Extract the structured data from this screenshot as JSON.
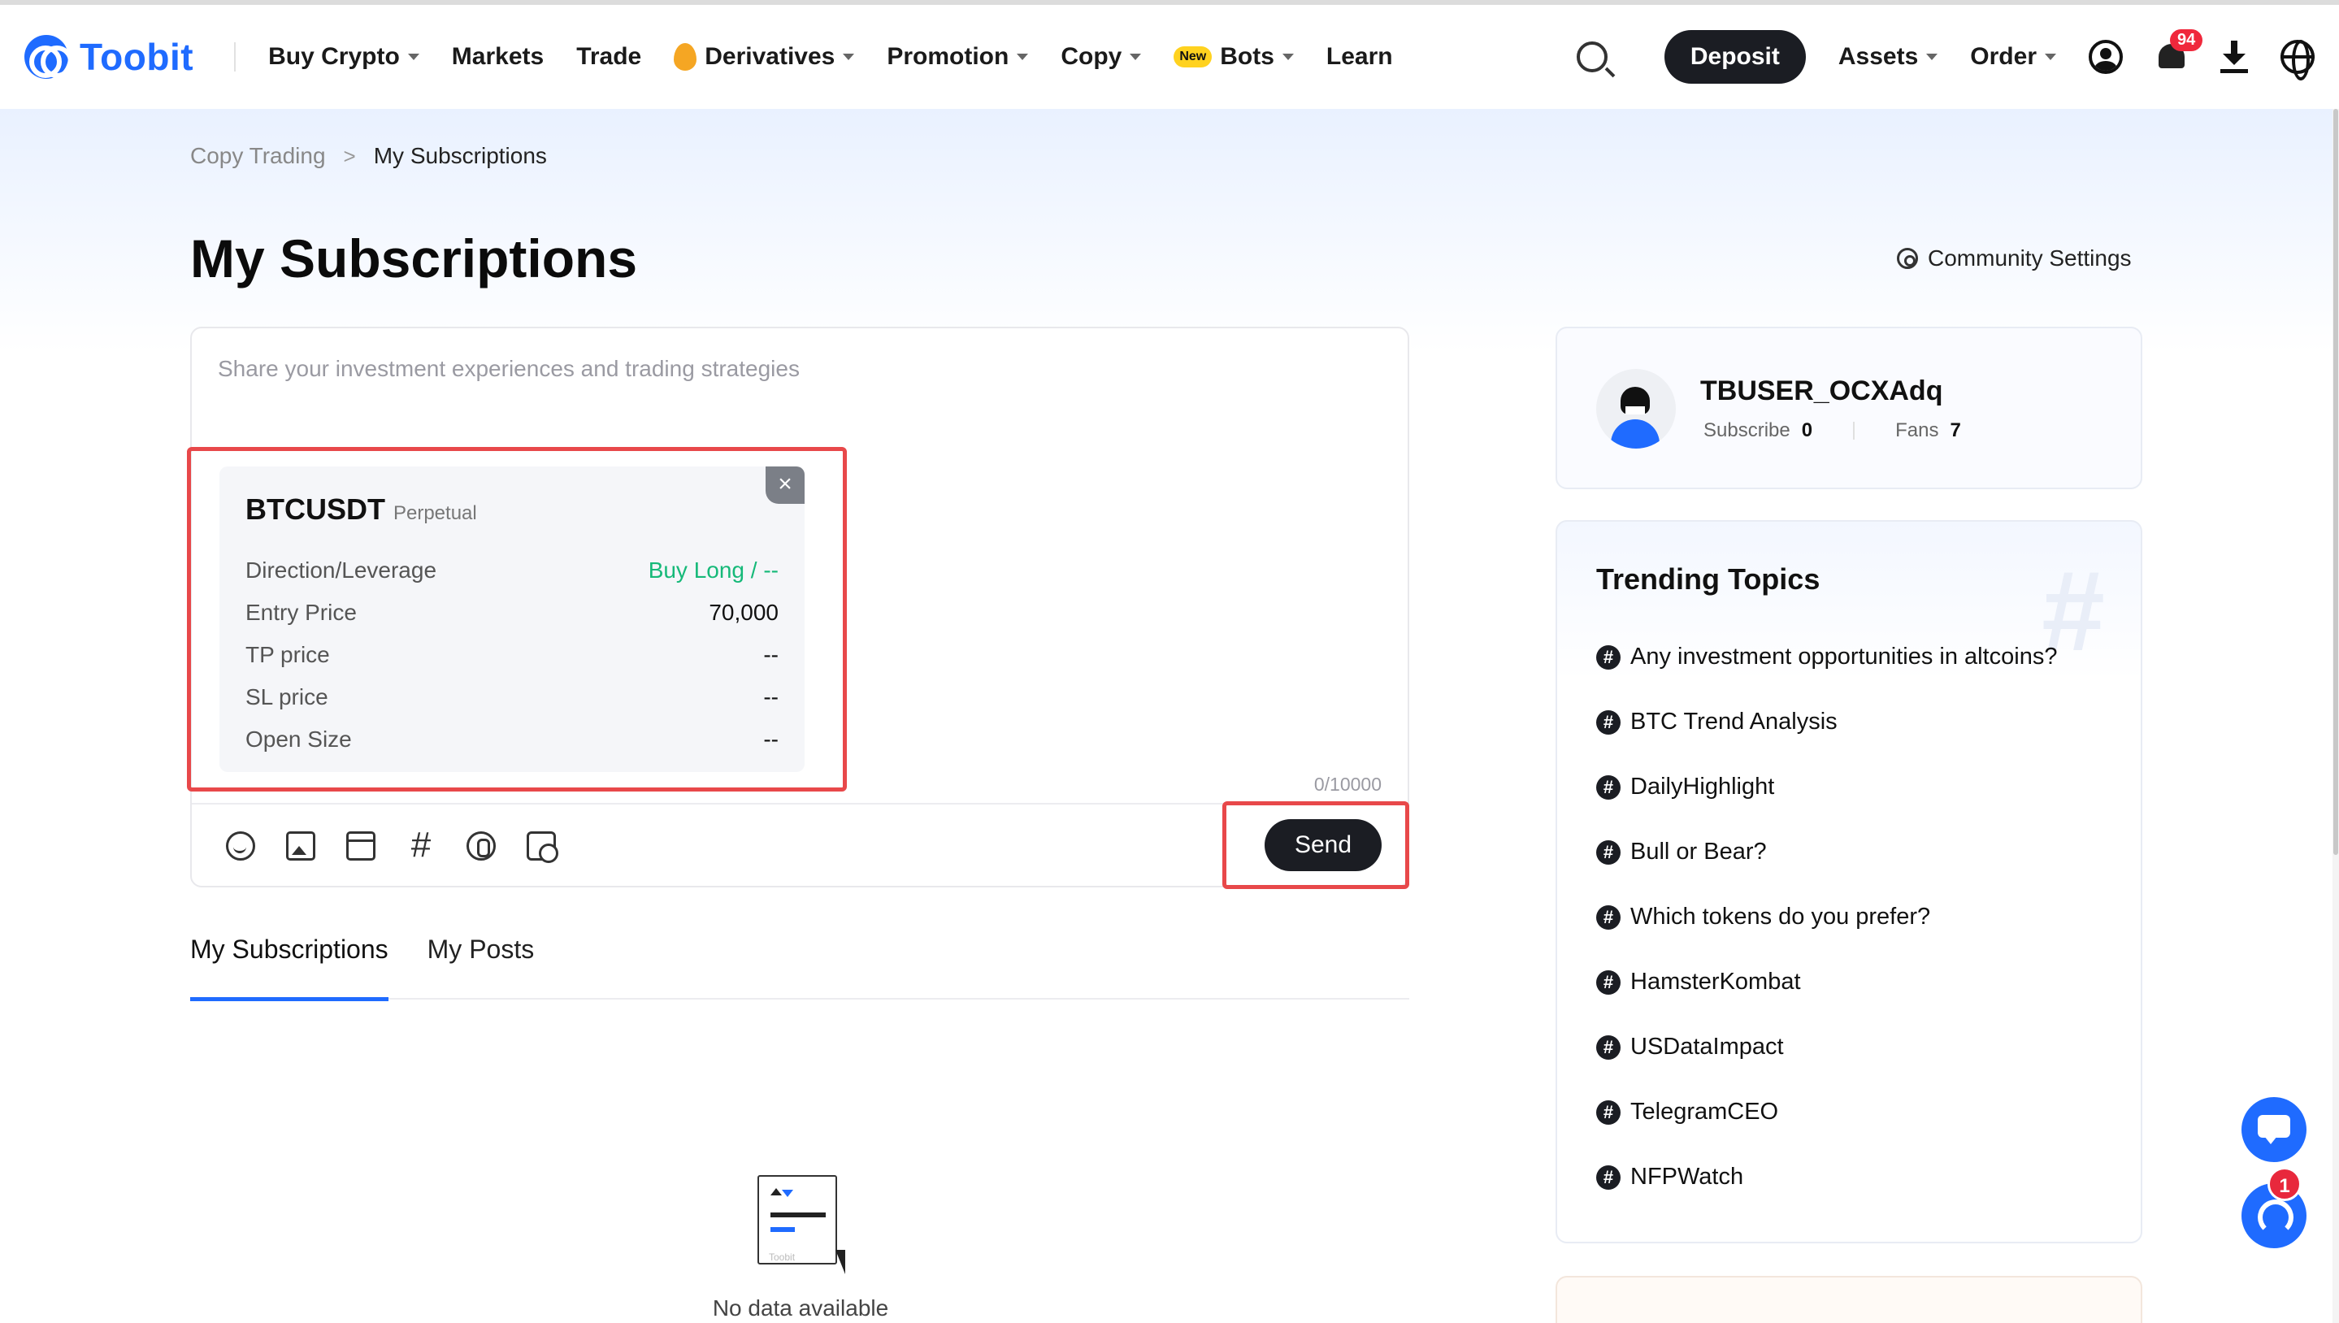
{
  "nav": {
    "logo": "Toobit",
    "items": [
      {
        "label": "Buy Crypto",
        "caret": true
      },
      {
        "label": "Markets",
        "caret": false
      },
      {
        "label": "Trade",
        "caret": false
      },
      {
        "label": "Derivatives",
        "caret": true,
        "icon": "flame-icon"
      },
      {
        "label": "Promotion",
        "caret": true
      },
      {
        "label": "Copy",
        "caret": true
      },
      {
        "label": "Bots",
        "caret": true,
        "badge": "New"
      },
      {
        "label": "Learn",
        "caret": false
      }
    ],
    "deposit": "Deposit",
    "assets": "Assets",
    "order": "Order",
    "notification_count": "94"
  },
  "breadcrumb": {
    "parent": "Copy Trading",
    "separator": ">",
    "current": "My Subscriptions"
  },
  "page_title": "My Subscriptions",
  "community_settings": "Community Settings",
  "composer": {
    "placeholder": "Share your investment experiences and trading strategies",
    "counter": "0/10000",
    "send": "Send",
    "card": {
      "symbol": "BTCUSDT",
      "type": "Perpetual",
      "close": "×",
      "rows": [
        {
          "label": "Direction/Leverage",
          "value": "Buy Long / --"
        },
        {
          "label": "Entry Price",
          "value": "70,000"
        },
        {
          "label": "TP price",
          "value": "--"
        },
        {
          "label": "SL price",
          "value": "--"
        },
        {
          "label": "Open Size",
          "value": "--"
        }
      ]
    },
    "tools": [
      "emoji-icon",
      "image-icon",
      "video-icon",
      "hashtag-icon",
      "coin-icon",
      "schedule-icon"
    ]
  },
  "tabs": [
    {
      "label": "My Subscriptions",
      "active": true
    },
    {
      "label": "My Posts",
      "active": false
    }
  ],
  "empty": {
    "text": "No data available",
    "mini_logo": "Toobit"
  },
  "profile": {
    "username": "TBUSER_OCXAdq",
    "subscribe_label": "Subscribe",
    "subscribe_count": "0",
    "fans_label": "Fans",
    "fans_count": "7"
  },
  "trending": {
    "title": "Trending Topics",
    "topics": [
      "Any investment opportunities in altcoins?",
      "BTC Trend Analysis",
      "DailyHighlight",
      "Bull or Bear?",
      "Which tokens do you prefer?",
      "HamsterKombat",
      "USDataImpact",
      "TelegramCEO",
      "NFPWatch"
    ]
  },
  "support_badge": "1",
  "colors": {
    "brand": "#1f6bff",
    "long_green": "#16b979",
    "highlight_red": "#e8484a",
    "dark_button": "#1b1d23"
  }
}
